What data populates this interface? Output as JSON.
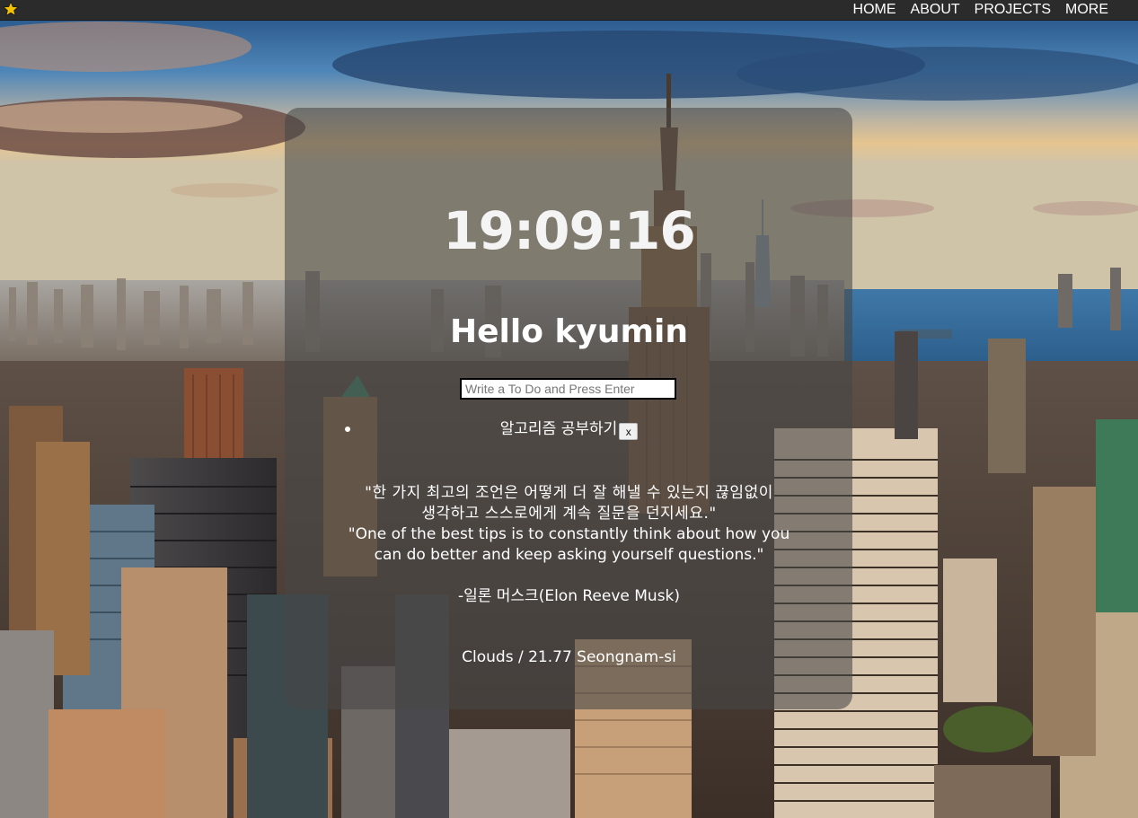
{
  "nav": {
    "logo_icon": "star-icon",
    "links": [
      "HOME",
      "ABOUT",
      "PROJECTS",
      "MORE"
    ]
  },
  "clock": {
    "time": "19:09:16"
  },
  "greeting": {
    "text": "Hello kyumin"
  },
  "todo": {
    "placeholder": "Write a To Do and Press Enter",
    "value": "",
    "items": [
      {
        "text": "알고리즘 공부하기",
        "delete_label": "x"
      }
    ]
  },
  "quote": {
    "korean_line1": "\"한 가지 최고의 조언은 어떻게 더 잘 해낼 수 있는지 끊임없이",
    "korean_line2": "생각하고 스스로에게 계속 질문을 던지세요.\"",
    "english_line1": "\"One of the best tips is to constantly think about how you",
    "english_line2": "can do better and keep asking yourself questions.\"",
    "author": "-일론 머스크(Elon Reeve Musk)"
  },
  "weather": {
    "text": "Clouds / 21.77 Seongnam-si"
  },
  "colors": {
    "nav_background": "#2b2b2b",
    "panel_overlay": "rgba(70,70,70,0.58)",
    "star": "#f2c200",
    "text": "#ffffff"
  }
}
